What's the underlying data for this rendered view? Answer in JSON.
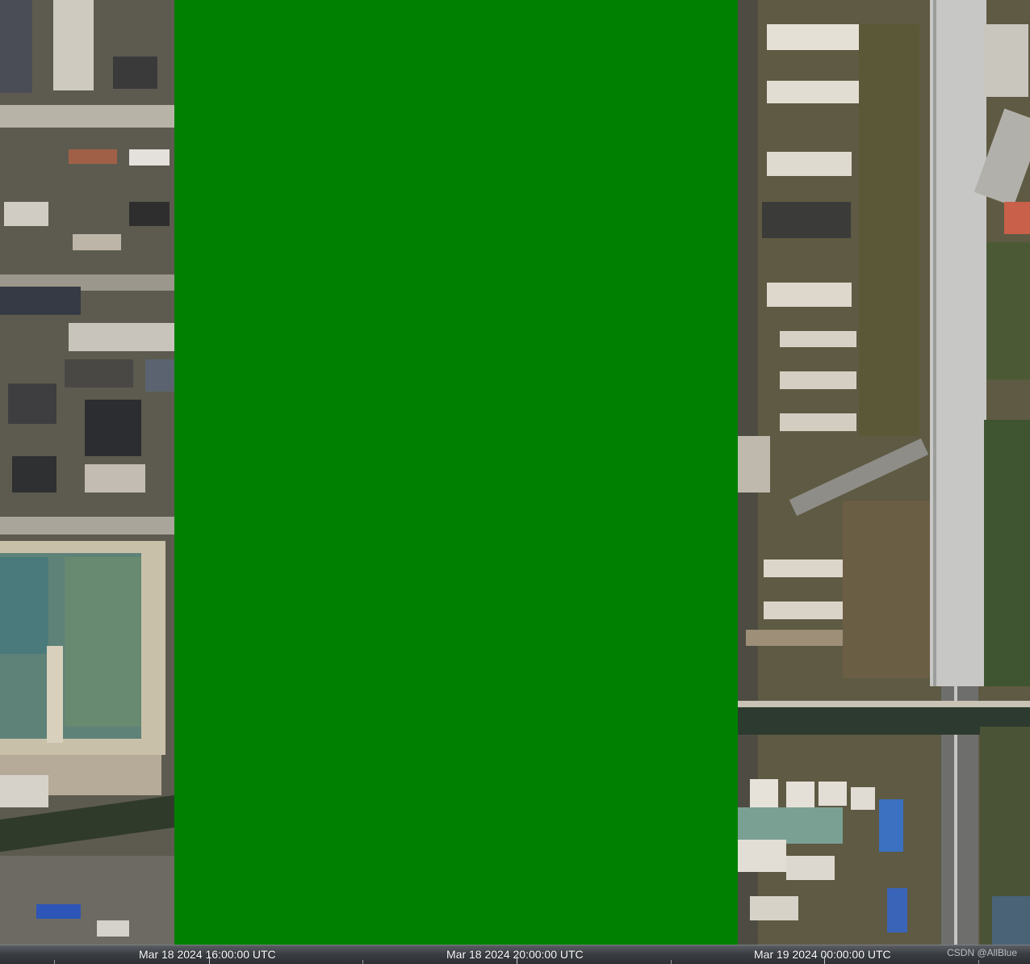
{
  "map": {
    "overlay_color": "#008000",
    "imagery": "satellite-imagery"
  },
  "timeline": {
    "labels": [
      "Mar 18 2024 16:00:00 UTC",
      "Mar 18 2024 20:00:00 UTC",
      "Mar 19 2024 00:00:00 UTC"
    ]
  },
  "watermark": {
    "text": "CSDN @AllBlue"
  }
}
